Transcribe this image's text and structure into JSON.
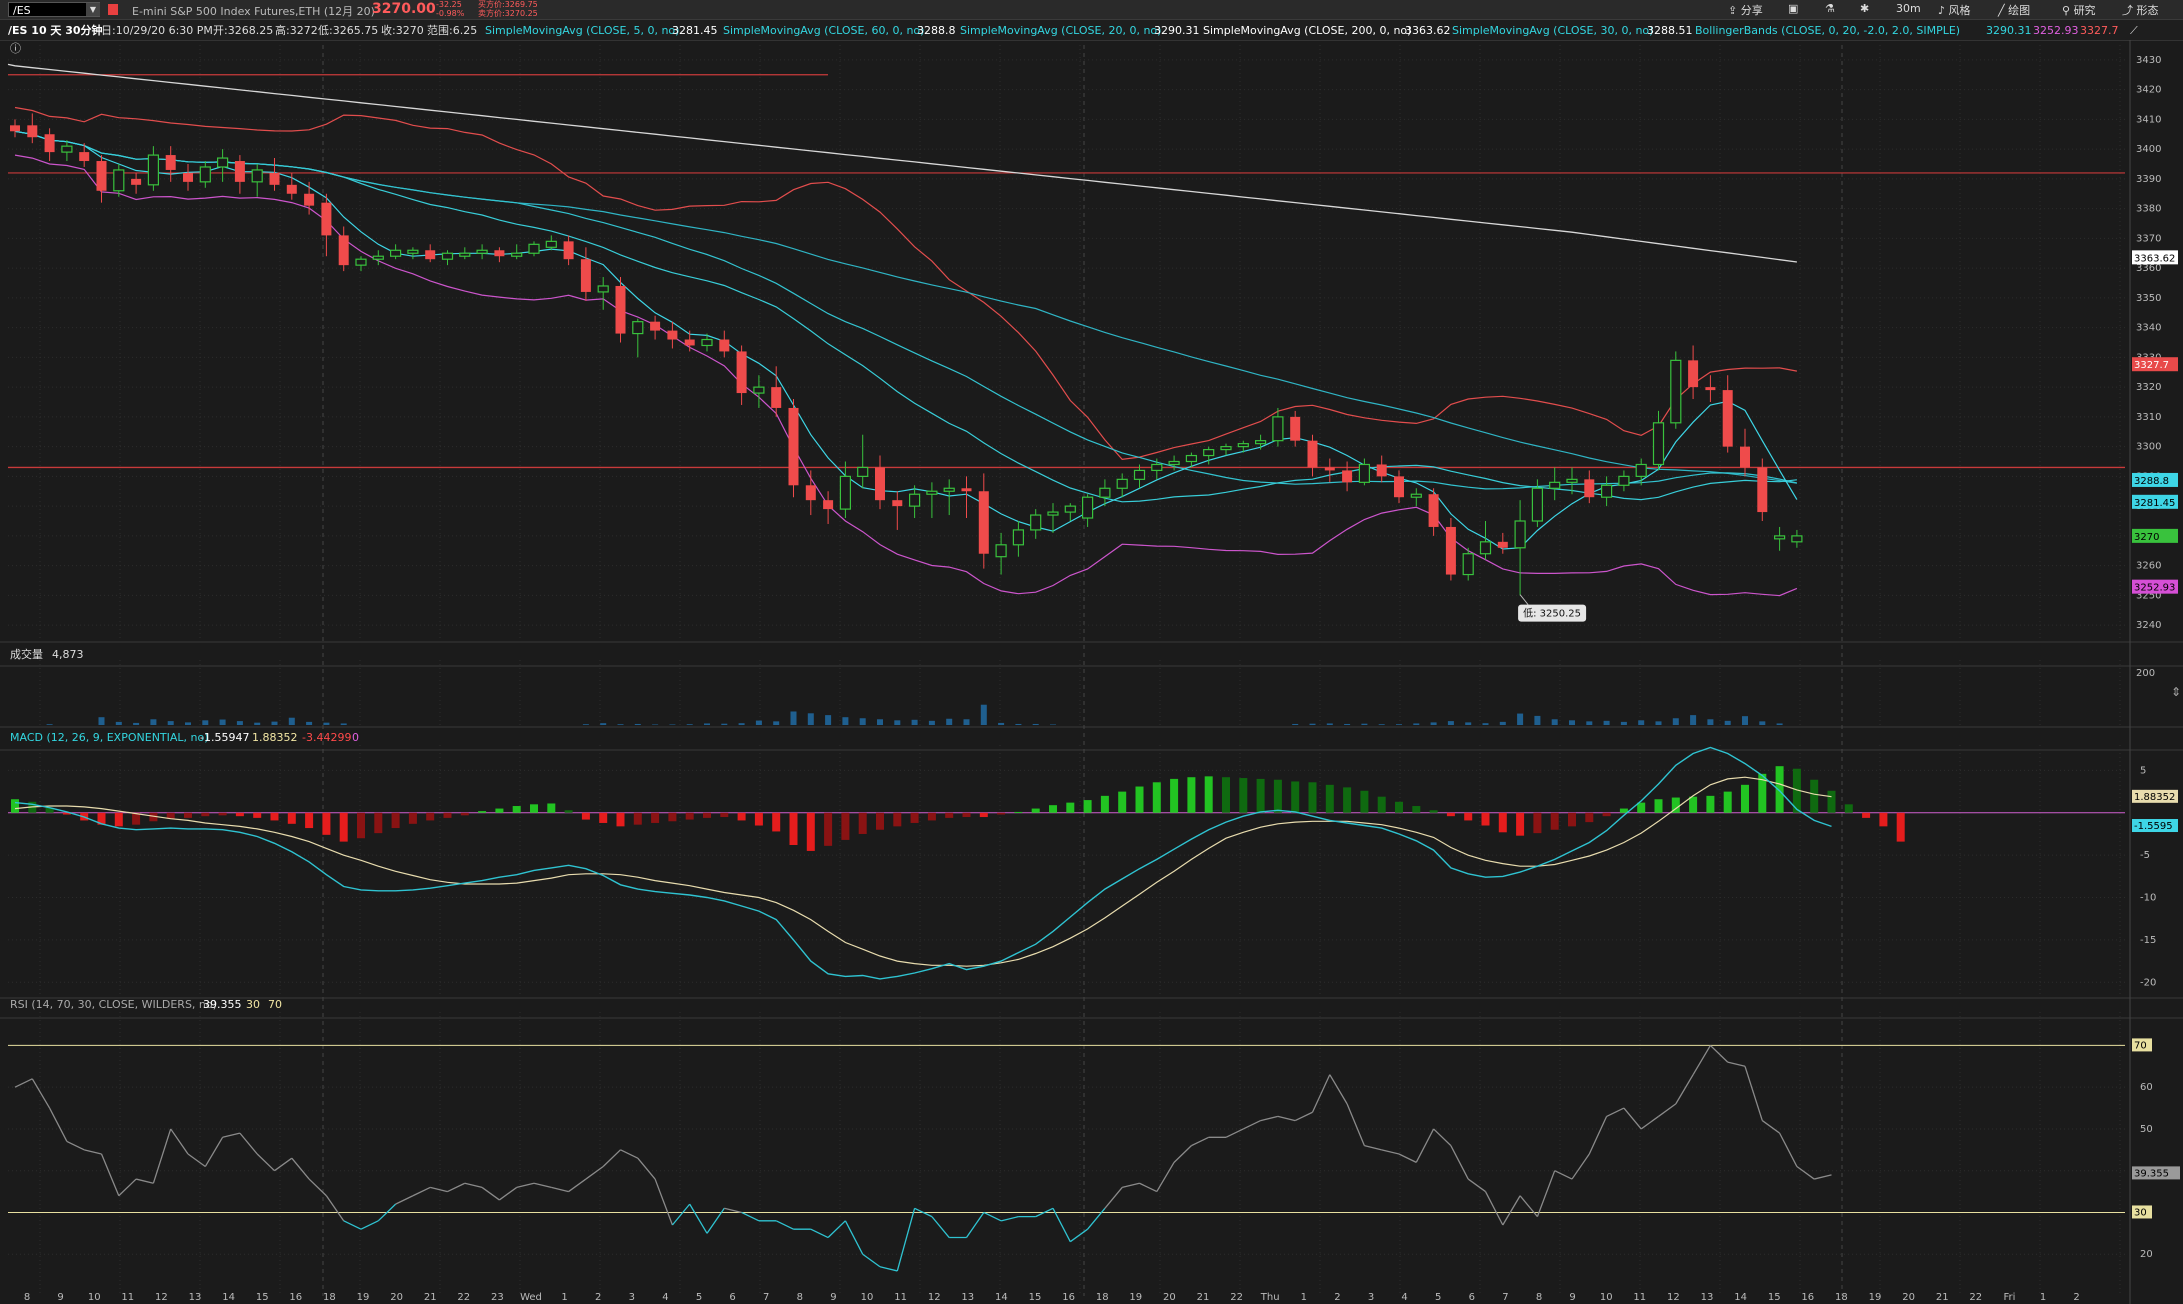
{
  "toolbar": {
    "symbol": "/ES",
    "description": "E-mini S&P 500 Index Futures,ETH (12月 20)",
    "last_price": "3270.00",
    "net_change": "-32.25",
    "pct_change": "-0.98%",
    "bid": "买方价:3269.75",
    "ask": "卖方价:3270.25",
    "share_label": "分享",
    "interval_label": "30m",
    "style_label": "风格",
    "drawing_label": "绘图",
    "studies_label": "研究",
    "pattern_label": "形态"
  },
  "status": {
    "title": "/ES 10 天 30分钟",
    "date": "日:10/29/20 6:30 PM",
    "open": "开:3268.25",
    "high": "高:3272",
    "low": "低:3265.75",
    "close": "收:3270",
    "range": "范围:6.25",
    "studies": [
      {
        "label": "SimpleMovingAvg (CLOSE, 5, 0, no)",
        "value": "3281.45",
        "color": "#33d6e0"
      },
      {
        "label": "SimpleMovingAvg (CLOSE, 60, 0, no)",
        "value": "3288.8",
        "color": "#33d6e0"
      },
      {
        "label": "SimpleMovingAvg (CLOSE, 20, 0, no)",
        "value": "3290.31",
        "color": "#33d6e0"
      },
      {
        "label": "SimpleMovingAvg (CLOSE, 200, 0, no)",
        "value": "3363.62",
        "color": "#ffffff"
      },
      {
        "label": "SimpleMovingAvg (CLOSE, 30, 0, no)",
        "value": "3288.51",
        "color": "#33d6e0"
      },
      {
        "label": "BollingerBands (CLOSE, 0, 20, -2.0, 2.0, SIMPLE)",
        "value": "3290.31",
        "color": "#33d6e0"
      }
    ],
    "bb_lower": "3252.93",
    "bb_upper": "3327.7"
  },
  "price_pane": {
    "y_ticks": [
      "3430",
      "3420",
      "3410",
      "3400",
      "3390",
      "3380",
      "3370",
      "3360",
      "3350",
      "3340",
      "3330",
      "3320",
      "3310",
      "3300",
      "3290",
      "3280",
      "3270",
      "3260",
      "3250",
      "3240"
    ],
    "tags": [
      {
        "text": "3363.62",
        "bg": "#ffffff",
        "fg": "#000000",
        "value": 3363.62
      },
      {
        "text": "3327.7",
        "bg": "#e84a4a",
        "fg": "#ffffff",
        "value": 3327.7
      },
      {
        "text": "3288.8",
        "bg": "#3ed6e6",
        "fg": "#000000",
        "value": 3288.8
      },
      {
        "text": "3281.45",
        "bg": "#3ed6e6",
        "fg": "#000000",
        "value": 3281.45
      },
      {
        "text": "3270",
        "bg": "#39c23d",
        "fg": "#000000",
        "value": 3270
      },
      {
        "text": "3252.93",
        "bg": "#d64fd6",
        "fg": "#000000",
        "value": 3252.93
      }
    ],
    "low_annotation": "低: 3250.25"
  },
  "volume_pane": {
    "title": "成交量",
    "value": "4,873",
    "y_tick": "200"
  },
  "macd_pane": {
    "title": "MACD (12, 26, 9, EXPONENTIAL, no)",
    "value": "-1.55947",
    "avg": "1.88352",
    "diff": "-3.44299",
    "zero": "0",
    "y_ticks": [
      "5",
      "-5",
      "-10",
      "-15",
      "-20"
    ],
    "tag_avg": "1.88352",
    "tag_value": "-1.5595"
  },
  "rsi_pane": {
    "title": "RSI (14, 70, 30, CLOSE, WILDERS, no)",
    "value": "39.355",
    "oversold": "30",
    "overbought": "70",
    "y_ticks": [
      "60",
      "50",
      "40",
      "20"
    ],
    "tag_value": "39.355"
  },
  "x_axis": {
    "labels": [
      "8",
      "9",
      "10",
      "11",
      "12",
      "13",
      "14",
      "15",
      "16",
      "18",
      "19",
      "20",
      "21",
      "22",
      "23",
      "Wed",
      "1",
      "2",
      "3",
      "4",
      "5",
      "6",
      "7",
      "8",
      "9",
      "10",
      "11",
      "12",
      "13",
      "14",
      "15",
      "16",
      "18",
      "19",
      "20",
      "21",
      "22",
      "Thu",
      "1",
      "2",
      "3",
      "4",
      "5",
      "6",
      "7",
      "8",
      "9",
      "10",
      "11",
      "12",
      "13",
      "14",
      "15",
      "16",
      "18",
      "19",
      "20",
      "21",
      "22",
      "Fri",
      "1",
      "2"
    ]
  },
  "chart_data": {
    "type": "candlestick",
    "interval": "30分钟",
    "ylim": [
      3235,
      3435
    ],
    "ohlc": [
      [
        3408,
        3410,
        3404,
        3406
      ],
      [
        3408,
        3412,
        3402,
        3404
      ],
      [
        3405,
        3407,
        3396,
        3399
      ],
      [
        3399,
        3403,
        3396,
        3401
      ],
      [
        3399,
        3402,
        3394,
        3396
      ],
      [
        3396,
        3398,
        3382,
        3386
      ],
      [
        3386,
        3395,
        3384,
        3393
      ],
      [
        3390,
        3392,
        3385,
        3388
      ],
      [
        3388,
        3401,
        3386,
        3398
      ],
      [
        3398,
        3401,
        3389,
        3393
      ],
      [
        3392,
        3395,
        3386,
        3389
      ],
      [
        3389,
        3396,
        3387,
        3394
      ],
      [
        3394,
        3400,
        3389,
        3397
      ],
      [
        3396,
        3398,
        3385,
        3389
      ],
      [
        3389,
        3395,
        3384,
        3393
      ],
      [
        3392,
        3397,
        3386,
        3388
      ],
      [
        3388,
        3392,
        3383,
        3385
      ],
      [
        3385,
        3389,
        3378,
        3381
      ],
      [
        3382,
        3385,
        3364,
        3371
      ],
      [
        3371,
        3374,
        3359,
        3361
      ],
      [
        3361,
        3364,
        3359,
        3363
      ],
      [
        3363,
        3366,
        3361,
        3364
      ],
      [
        3364,
        3368,
        3363,
        3366
      ],
      [
        3365,
        3367,
        3363,
        3366
      ],
      [
        3366,
        3368,
        3362,
        3363
      ],
      [
        3363,
        3366,
        3361,
        3365
      ],
      [
        3364,
        3367,
        3363,
        3365
      ],
      [
        3365,
        3368,
        3363,
        3366
      ],
      [
        3366,
        3367,
        3362,
        3364
      ],
      [
        3364,
        3368,
        3363,
        3365
      ],
      [
        3365,
        3369,
        3364,
        3368
      ],
      [
        3367,
        3371,
        3366,
        3369
      ],
      [
        3369,
        3371,
        3361,
        3363
      ],
      [
        3363,
        3367,
        3349,
        3352
      ],
      [
        3352,
        3357,
        3346,
        3354
      ],
      [
        3354,
        3357,
        3335,
        3338
      ],
      [
        3338,
        3343,
        3330,
        3342
      ],
      [
        3342,
        3344,
        3336,
        3339
      ],
      [
        3339,
        3342,
        3333,
        3336
      ],
      [
        3336,
        3339,
        3332,
        3334
      ],
      [
        3334,
        3338,
        3332,
        3336
      ],
      [
        3336,
        3339,
        3330,
        3332
      ],
      [
        3332,
        3334,
        3314,
        3318
      ],
      [
        3318,
        3324,
        3313,
        3320
      ],
      [
        3320,
        3327,
        3310,
        3313
      ],
      [
        3313,
        3316,
        3283,
        3287
      ],
      [
        3287,
        3292,
        3277,
        3282
      ],
      [
        3282,
        3285,
        3274,
        3279
      ],
      [
        3279,
        3295,
        3276,
        3290
      ],
      [
        3290,
        3304,
        3286,
        3293
      ],
      [
        3293,
        3297,
        3279,
        3282
      ],
      [
        3282,
        3285,
        3272,
        3280
      ],
      [
        3280,
        3287,
        3276,
        3284
      ],
      [
        3284,
        3288,
        3276,
        3285
      ],
      [
        3285,
        3289,
        3277,
        3286
      ],
      [
        3286,
        3290,
        3276,
        3285
      ],
      [
        3285,
        3291,
        3259,
        3264
      ],
      [
        3263,
        3271,
        3257,
        3267
      ],
      [
        3267,
        3275,
        3263,
        3272
      ],
      [
        3272,
        3279,
        3269,
        3277
      ],
      [
        3277,
        3281,
        3271,
        3278
      ],
      [
        3278,
        3281,
        3275,
        3280
      ],
      [
        3276,
        3284,
        3273,
        3283
      ],
      [
        3283,
        3289,
        3280,
        3286
      ],
      [
        3286,
        3291,
        3283,
        3289
      ],
      [
        3289,
        3294,
        3286,
        3292
      ],
      [
        3292,
        3296,
        3289,
        3294
      ],
      [
        3294,
        3297,
        3292,
        3295
      ],
      [
        3295,
        3298,
        3293,
        3297
      ],
      [
        3297,
        3300,
        3294,
        3299
      ],
      [
        3299,
        3301,
        3297,
        3300
      ],
      [
        3300,
        3302,
        3298,
        3301
      ],
      [
        3301,
        3304,
        3299,
        3302
      ],
      [
        3302,
        3313,
        3300,
        3310
      ],
      [
        3310,
        3312,
        3300,
        3302
      ],
      [
        3302,
        3304,
        3290,
        3293
      ],
      [
        3293,
        3296,
        3288,
        3292
      ],
      [
        3292,
        3295,
        3285,
        3288
      ],
      [
        3288,
        3296,
        3287,
        3294
      ],
      [
        3294,
        3297,
        3288,
        3290
      ],
      [
        3290,
        3292,
        3281,
        3283
      ],
      [
        3283,
        3286,
        3280,
        3284
      ],
      [
        3284,
        3286,
        3270,
        3273
      ],
      [
        3273,
        3276,
        3255,
        3257
      ],
      [
        3257,
        3266,
        3255,
        3264
      ],
      [
        3264,
        3275,
        3262,
        3268
      ],
      [
        3268,
        3271,
        3264,
        3266
      ],
      [
        3266,
        3282,
        3250,
        3275
      ],
      [
        3275,
        3289,
        3273,
        3286
      ],
      [
        3286,
        3293,
        3282,
        3288
      ],
      [
        3288,
        3293,
        3284,
        3289
      ],
      [
        3289,
        3292,
        3281,
        3283
      ],
      [
        3283,
        3290,
        3280,
        3287
      ],
      [
        3287,
        3292,
        3285,
        3290
      ],
      [
        3290,
        3296,
        3287,
        3294
      ],
      [
        3294,
        3312,
        3292,
        3308
      ],
      [
        3308,
        3332,
        3306,
        3329
      ],
      [
        3329,
        3334,
        3316,
        3320
      ],
      [
        3320,
        3324,
        3315,
        3319
      ],
      [
        3319,
        3324,
        3298,
        3300
      ],
      [
        3300,
        3306,
        3290,
        3293
      ],
      [
        3293,
        3296,
        3275,
        3278
      ],
      [
        3269,
        3273,
        3265,
        3270
      ],
      [
        3268,
        3272,
        3266,
        3270
      ]
    ],
    "volume_ylim": [
      0,
      250
    ],
    "volume": [
      0,
      0,
      3,
      0,
      0,
      30,
      12,
      8,
      22,
      15,
      10,
      18,
      21,
      15,
      9,
      13,
      28,
      12,
      9,
      6,
      0,
      0,
      0,
      0,
      0,
      0,
      0,
      0,
      0,
      0,
      0,
      0,
      0,
      3,
      7,
      3,
      4,
      2,
      2,
      3,
      6,
      5,
      7,
      17,
      14,
      52,
      45,
      38,
      30,
      26,
      22,
      18,
      20,
      16,
      24,
      22,
      78,
      8,
      4,
      4,
      2,
      0,
      0,
      0,
      0,
      0,
      0,
      0,
      0,
      0,
      0,
      0,
      0,
      0,
      4,
      5,
      6,
      4,
      5,
      3,
      3,
      6,
      10,
      15,
      10,
      7,
      12,
      44,
      35,
      22,
      18,
      14,
      16,
      12,
      18,
      14,
      26,
      38,
      22,
      16,
      34,
      14,
      6,
      0
    ],
    "macd_ylim": [
      -21.5,
      8
    ],
    "macd_hist": [
      1.6,
      1.3,
      0.6,
      -0.2,
      -0.9,
      -1.4,
      -1.6,
      -1.4,
      -1.0,
      -0.7,
      -0.6,
      -0.4,
      -0.3,
      -0.4,
      -0.6,
      -0.9,
      -1.3,
      -1.8,
      -2.6,
      -3.4,
      -3.0,
      -2.4,
      -1.8,
      -1.3,
      -0.9,
      -0.6,
      -0.3,
      0.2,
      0.5,
      0.8,
      1.0,
      1.1,
      0.3,
      -0.8,
      -1.2,
      -1.6,
      -1.4,
      -1.2,
      -1.0,
      -0.8,
      -0.6,
      -0.5,
      -0.9,
      -1.5,
      -2.2,
      -3.8,
      -4.5,
      -3.9,
      -3.2,
      -2.5,
      -2.0,
      -1.6,
      -1.2,
      -0.9,
      -0.6,
      -0.5,
      -0.5,
      -0.2,
      0.1,
      0.5,
      0.9,
      1.2,
      1.5,
      2.0,
      2.5,
      3.1,
      3.6,
      4.0,
      4.2,
      4.3,
      4.2,
      4.1,
      4.0,
      3.9,
      3.7,
      3.6,
      3.3,
      3.0,
      2.6,
      1.9,
      1.3,
      0.8,
      0.3,
      -0.4,
      -0.9,
      -1.5,
      -2.3,
      -2.7,
      -2.4,
      -2.0,
      -1.6,
      -1.1,
      -0.4,
      0.5,
      1.2,
      1.6,
      1.8,
      1.9,
      2.0,
      2.5,
      3.3,
      4.6,
      5.5,
      5.2,
      3.9,
      2.6,
      1.0,
      -0.6,
      -1.6,
      -3.4
    ],
    "macd_value": [
      1.2,
      1.0,
      0.6,
      0.1,
      -0.5,
      -1.3,
      -1.8,
      -2.0,
      -1.9,
      -1.8,
      -1.9,
      -1.9,
      -2.0,
      -2.3,
      -2.8,
      -3.6,
      -4.6,
      -5.8,
      -7.3,
      -8.7,
      -9.1,
      -9.2,
      -9.2,
      -9.1,
      -8.9,
      -8.6,
      -8.3,
      -8.0,
      -7.6,
      -7.3,
      -6.8,
      -6.5,
      -6.2,
      -6.6,
      -7.4,
      -8.5,
      -9.0,
      -9.3,
      -9.5,
      -9.7,
      -10.0,
      -10.4,
      -11.0,
      -11.6,
      -12.6,
      -15.0,
      -17.5,
      -19.0,
      -19.3,
      -19.2,
      -19.6,
      -19.3,
      -18.9,
      -18.4,
      -17.8,
      -18.5,
      -18.1,
      -17.5,
      -16.5,
      -15.5,
      -14.0,
      -12.3,
      -10.6,
      -9.0,
      -7.8,
      -6.6,
      -5.5,
      -4.3,
      -3.1,
      -2.0,
      -1.1,
      -0.4,
      0.1,
      0.3,
      0.1,
      -0.4,
      -0.9,
      -1.2,
      -1.5,
      -1.8,
      -2.5,
      -3.3,
      -4.4,
      -6.5,
      -7.2,
      -7.6,
      -7.5,
      -7.0,
      -6.3,
      -5.5,
      -4.5,
      -3.5,
      -2.1,
      -0.3,
      1.4,
      3.4,
      5.6,
      7.0,
      7.7,
      7.0,
      5.8,
      4.4,
      2.6,
      0.4,
      -0.9,
      -1.6
    ],
    "macd_avg": [
      0.5,
      0.7,
      0.8,
      0.8,
      0.7,
      0.5,
      0.2,
      -0.1,
      -0.4,
      -0.7,
      -0.9,
      -1.2,
      -1.4,
      -1.6,
      -1.9,
      -2.3,
      -2.8,
      -3.4,
      -4.2,
      -5.0,
      -5.6,
      -6.3,
      -6.9,
      -7.4,
      -7.9,
      -8.2,
      -8.4,
      -8.4,
      -8.4,
      -8.3,
      -8.0,
      -7.7,
      -7.3,
      -7.2,
      -7.2,
      -7.3,
      -7.6,
      -8.0,
      -8.3,
      -8.6,
      -9.0,
      -9.4,
      -9.7,
      -10.0,
      -10.6,
      -11.5,
      -12.6,
      -14.0,
      -15.3,
      -16.1,
      -16.9,
      -17.5,
      -17.8,
      -18.0,
      -18.0,
      -18.1,
      -18.0,
      -17.7,
      -17.3,
      -16.6,
      -15.8,
      -14.8,
      -13.7,
      -12.4,
      -11.0,
      -9.6,
      -8.2,
      -6.9,
      -5.5,
      -4.2,
      -3.0,
      -2.3,
      -1.7,
      -1.3,
      -1.1,
      -1.0,
      -1.0,
      -1.0,
      -1.2,
      -1.4,
      -1.8,
      -2.3,
      -2.9,
      -4.1,
      -5.0,
      -5.6,
      -6.0,
      -6.3,
      -6.3,
      -6.1,
      -5.6,
      -5.1,
      -4.4,
      -3.5,
      -2.4,
      -1.0,
      0.5,
      2.0,
      3.3,
      4.0,
      4.2,
      3.9,
      3.4,
      2.7,
      2.2,
      1.9
    ],
    "rsi_ylim": [
      10,
      78
    ],
    "rsi": [
      60,
      62,
      55,
      47,
      45,
      44,
      34,
      38,
      37,
      50,
      44,
      41,
      48,
      49,
      44,
      40,
      43,
      38,
      34,
      28,
      26,
      28,
      32,
      34,
      36,
      35,
      37,
      36,
      33,
      36,
      37,
      36,
      35,
      38,
      41,
      45,
      43,
      38,
      27,
      32,
      25,
      31,
      30,
      28,
      28,
      26,
      26,
      24,
      28,
      20,
      17,
      16,
      31,
      29,
      24,
      24,
      30,
      28,
      29,
      29,
      31,
      23,
      26,
      31,
      36,
      37,
      35,
      42,
      46,
      48,
      48,
      50,
      52,
      53,
      52,
      54,
      63,
      56,
      46,
      45,
      44,
      42,
      50,
      46,
      38,
      35,
      27,
      34,
      29,
      40,
      38,
      44,
      53,
      55,
      50,
      53,
      56,
      63,
      70,
      66,
      65,
      52,
      49,
      41,
      38,
      39
    ]
  }
}
